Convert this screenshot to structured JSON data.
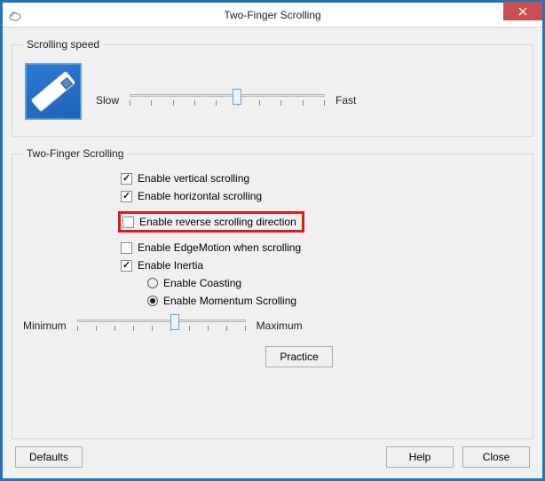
{
  "window": {
    "title": "Two-Finger Scrolling"
  },
  "groups": {
    "speed": {
      "legend": "Scrolling speed",
      "slow": "Slow",
      "fast": "Fast",
      "value_percent": 55,
      "ticks": 10
    },
    "twofinger": {
      "legend": "Two-Finger Scrolling",
      "opts": {
        "vertical": {
          "label": "Enable vertical scrolling",
          "checked": true
        },
        "horizontal": {
          "label": "Enable horizontal scrolling",
          "checked": true
        },
        "reverse": {
          "label": "Enable reverse scrolling direction",
          "checked": false
        },
        "edgemotion": {
          "label": "Enable EdgeMotion when scrolling",
          "checked": false
        },
        "inertia": {
          "label": "Enable Inertia",
          "checked": true
        }
      },
      "inertia_mode": {
        "coasting": {
          "label": "Enable Coasting",
          "selected": false
        },
        "momentum": {
          "label": "Enable Momentum Scrolling",
          "selected": true
        }
      },
      "inertia_slider": {
        "min_label": "Minimum",
        "max_label": "Maximum",
        "value_percent": 58,
        "ticks": 10
      },
      "practice": "Practice"
    }
  },
  "buttons": {
    "defaults": "Defaults",
    "help": "Help",
    "close": "Close"
  }
}
